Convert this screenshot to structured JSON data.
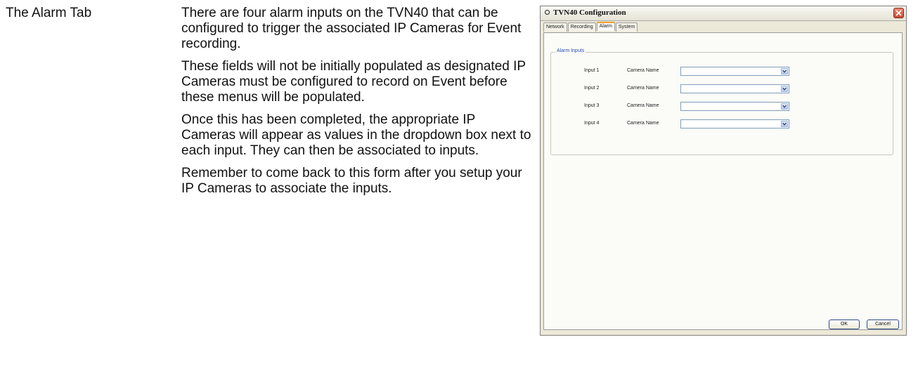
{
  "document": {
    "section_label": "The Alarm Tab",
    "paragraphs": [
      "There are four alarm inputs on the TVN40 that can be configured to trigger the associated IP Cameras for Event recording.",
      "These fields will not be initially populated as designated IP Cameras must be configured to record on Event before these menus will be populated.",
      "Once this has been completed, the appropriate IP Cameras will appear as values in the dropdown box next to each input. They can then be associated to inputs.",
      "Remember to come back to this form after you setup your IP Cameras to associate the inputs."
    ]
  },
  "dialog": {
    "title": "TVN40 Configuration",
    "tabs": [
      "Network",
      "Recording",
      "Alarm",
      "System"
    ],
    "active_tab": "Alarm",
    "group_title": "Alarm Inputs",
    "rows": [
      {
        "input": "Input 1",
        "label": "Camera Name",
        "value": ""
      },
      {
        "input": "Input 2",
        "label": "Camera Name",
        "value": ""
      },
      {
        "input": "Input 3",
        "label": "Camera Name",
        "value": ""
      },
      {
        "input": "Input 4",
        "label": "Camera Name",
        "value": ""
      }
    ],
    "ok_label": "OK",
    "cancel_label": "Cancel"
  }
}
